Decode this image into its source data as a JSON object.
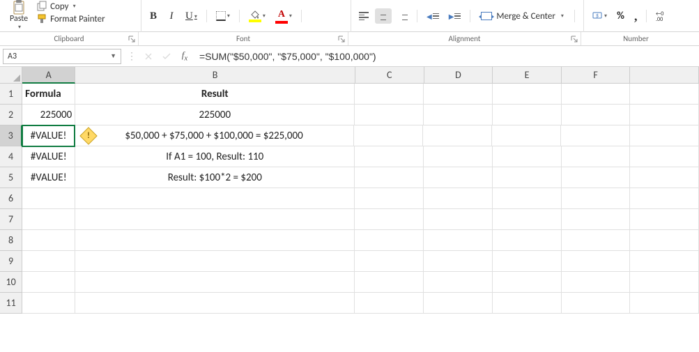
{
  "ribbon": {
    "clipboard": {
      "paste": "Paste",
      "copy": "Copy",
      "format_painter": "Format Painter"
    },
    "font": {
      "bold": "B",
      "italic": "I",
      "underline": "U"
    },
    "alignment": {
      "merge": "Merge & Center"
    },
    "number": {
      "percent": "%",
      "comma": ",",
      "inc_dec": "←0\n.00"
    }
  },
  "groups": {
    "clipboard": "Clipboard",
    "font": "Font",
    "alignment": "Alignment",
    "number": "Number"
  },
  "formula_bar": {
    "name_box": "A3",
    "formula": "=SUM(\"$50,000\", \"$75,000\", \"$100,000\")"
  },
  "columns": [
    "A",
    "B",
    "C",
    "D",
    "E",
    "F"
  ],
  "rows": [
    "1",
    "2",
    "3",
    "4",
    "5",
    "6",
    "7",
    "8",
    "9",
    "10",
    "11"
  ],
  "active_cell": {
    "row": 3,
    "col": "A"
  },
  "cells": {
    "A1": "Formula",
    "B1": "Result",
    "A2": "225000",
    "B2": "225000",
    "A3": "#VALUE!",
    "B3": "$50,000 + $75,000 + $100,000 = $225,000",
    "A4": "#VALUE!",
    "B4": "If A1 = 100, Result: 110",
    "A5": "#VALUE!",
    "B5": "Result: $100*2 = $200"
  },
  "error_indicator": "!"
}
